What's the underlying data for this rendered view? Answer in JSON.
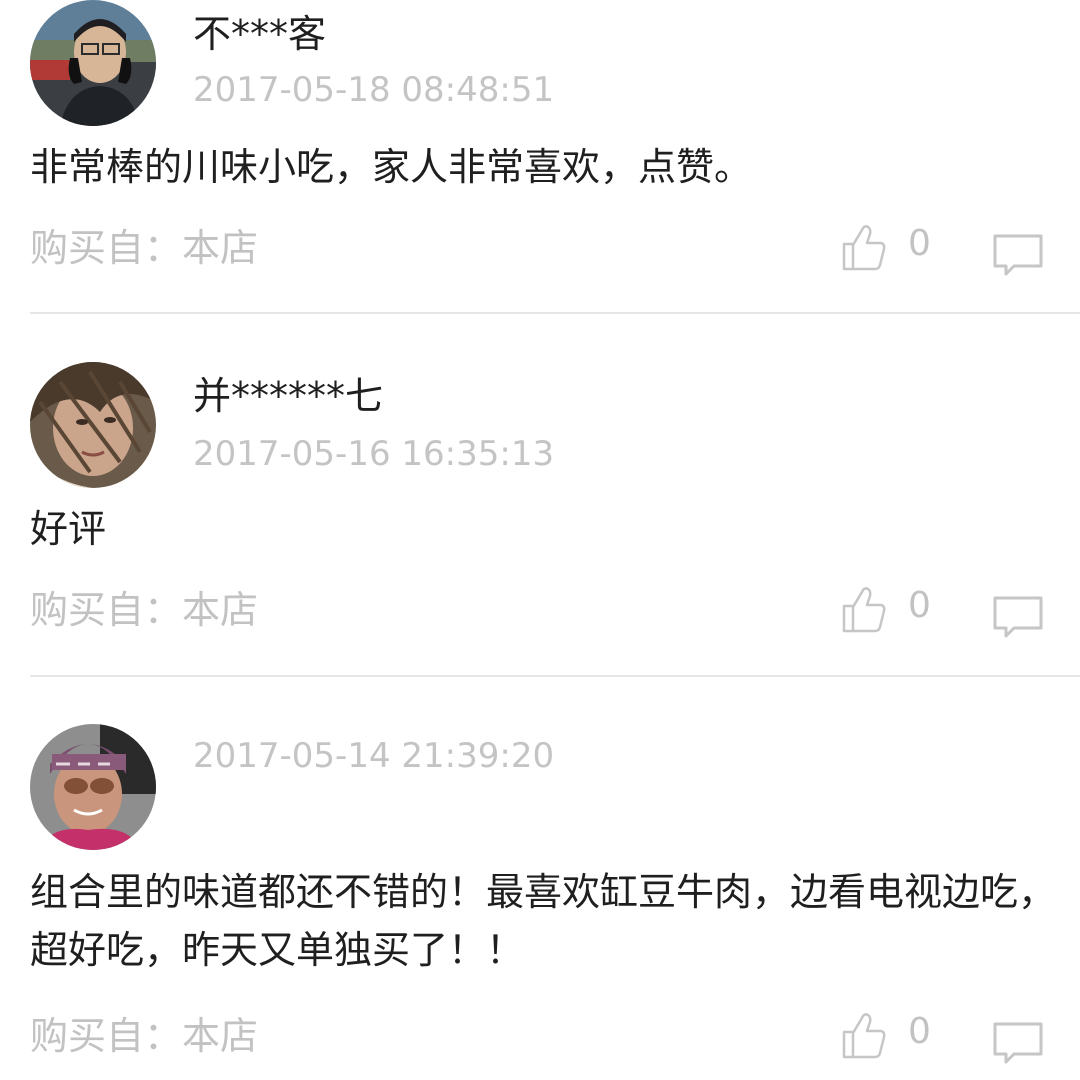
{
  "reviews": [
    {
      "username": "不***客",
      "timestamp": "2017-05-18 08:48:51",
      "content": "非常棒的川味小吃，家人非常喜欢，点赞。",
      "source": "购买自：本店",
      "likes": "0"
    },
    {
      "username": "并******七",
      "timestamp": "2017-05-16 16:35:13",
      "content": "好评",
      "source": "购买自：本店",
      "likes": "0"
    },
    {
      "username": "",
      "timestamp": "2017-05-14 21:39:20",
      "content": "组合里的味道都还不错的！最喜欢缸豆牛肉，边看电视边吃，超好吃，昨天又单独买了！！",
      "source": "购买自：本店",
      "likes": "0"
    }
  ],
  "icons": {
    "like": "thumbs-up-icon",
    "comment": "comment-bubble-icon"
  },
  "colors": {
    "text_primary": "#1f1f1f",
    "text_muted": "#c2c2c2",
    "divider": "#e6e6e6"
  }
}
